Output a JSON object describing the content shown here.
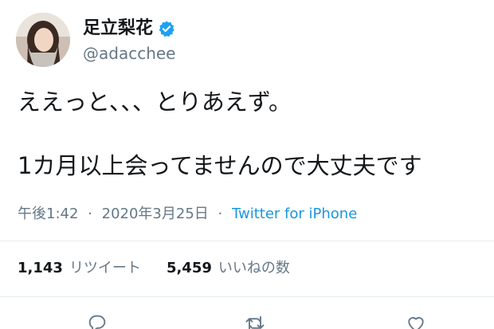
{
  "user": {
    "display_name": "足立梨花",
    "handle": "@adacchee",
    "verified": true
  },
  "tweet": {
    "line1": "ええっと、、、とりあえず。",
    "line2": "1カ月以上会ってませんので大丈夫です"
  },
  "meta": {
    "time": "午後1:42",
    "separator": "·",
    "date": "2020年3月25日",
    "source": "Twitter for iPhone"
  },
  "stats": {
    "retweets_count": "1,143",
    "retweets_label": "リツイート",
    "likes_count": "5,459",
    "likes_label": "いいねの数"
  },
  "colors": {
    "text": "#14171a",
    "secondary": "#657786",
    "link": "#1b95e0",
    "verified_badge": "#1da1f2",
    "divider": "#e6ecf0"
  },
  "icons": {
    "verified": "verified-badge-icon",
    "reply": "reply-icon",
    "retweet": "retweet-icon",
    "like": "heart-icon"
  }
}
